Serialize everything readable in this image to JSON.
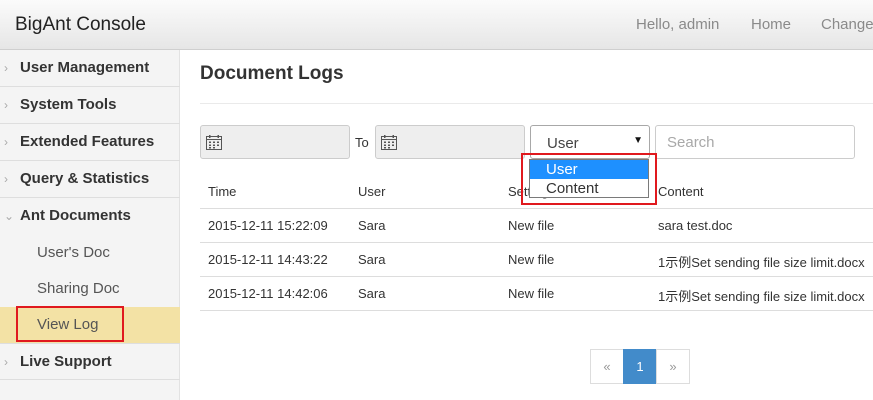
{
  "header": {
    "app_title": "BigAnt Console",
    "greeting": "Hello, admin",
    "home_link": "Home",
    "change_link": "Change"
  },
  "sidebar": {
    "items": [
      {
        "label": "User Management"
      },
      {
        "label": "System Tools"
      },
      {
        "label": "Extended Features"
      },
      {
        "label": "Query & Statistics"
      },
      {
        "label": "Ant Documents"
      },
      {
        "label": "Live Support"
      }
    ],
    "sub_items": [
      {
        "label": "User's Doc"
      },
      {
        "label": "Sharing Doc"
      },
      {
        "label": "View Log",
        "active": true
      }
    ]
  },
  "main": {
    "title": "Document Logs",
    "filter": {
      "to_label": "To",
      "field_select": {
        "selected": "User",
        "options": [
          "User",
          "Content"
        ]
      },
      "search_placeholder": "Search"
    },
    "table": {
      "headers": [
        "Time",
        "User",
        "Setting",
        "Content"
      ],
      "rows": [
        [
          "2015-12-11 15:22:09",
          "Sara",
          "New file",
          "sara test.doc"
        ],
        [
          "2015-12-11 14:43:22",
          "Sara",
          "New file",
          "1示例Set sending file size limit.docx"
        ],
        [
          "2015-12-11 14:42:06",
          "Sara",
          "New file",
          "1示例Set sending file size limit.docx"
        ]
      ]
    },
    "pagination": {
      "prev": "«",
      "current": "1",
      "next": "»"
    }
  },
  "colors": {
    "active_sidebar": "#f3e2a5",
    "highlight_box": "#e0191e",
    "dropdown_selected": "#1e90ff",
    "pager_active": "#428bca"
  }
}
